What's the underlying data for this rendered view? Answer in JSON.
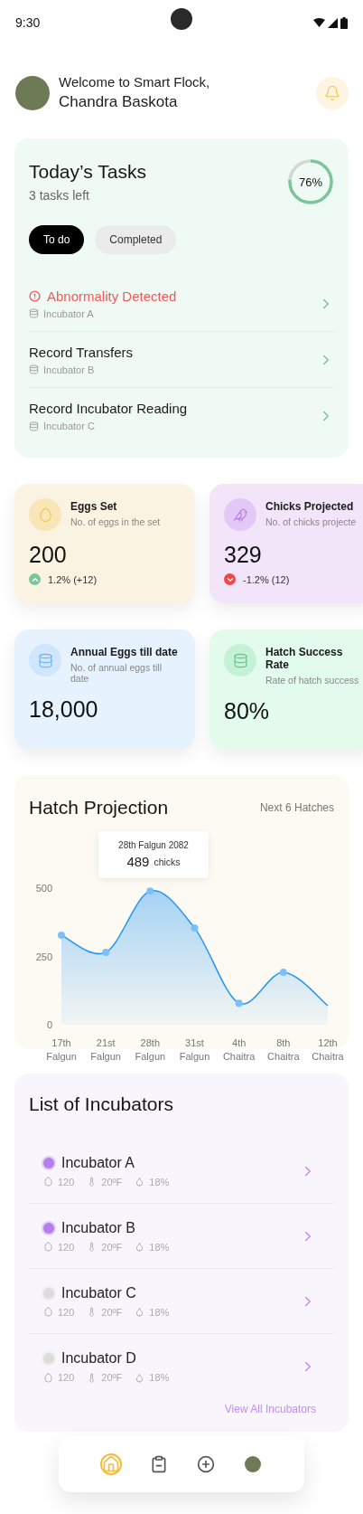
{
  "status_bar": {
    "time": "9:30"
  },
  "header": {
    "greeting": "Welcome to Smart Flock,",
    "name": "Chandra Baskota"
  },
  "tasks": {
    "title": "Today’s Tasks",
    "subtitle": "3 tasks left",
    "progress": {
      "level": 0.76,
      "label": "76%"
    },
    "tabs": [
      {
        "label": "To do",
        "selected": true
      },
      {
        "label": "Completed",
        "selected": false
      }
    ],
    "items": [
      {
        "kind": "alert",
        "title": "Abnormality Detected",
        "incubator": "Incubator A"
      },
      {
        "kind": "normal",
        "title": "Record Transfers",
        "incubator": "Incubator B"
      },
      {
        "kind": "normal",
        "title": "Record Incubator Reading",
        "incubator": "Incubator C"
      }
    ]
  },
  "stats": [
    {
      "kind": "egg",
      "title": "Eggs Set",
      "description": "No. of eggs in the set",
      "value": "200",
      "trend": {
        "kind": "up",
        "text": "1.2% (+12)"
      }
    },
    {
      "kind": "chick",
      "title": "Chicks Projected",
      "description": "No. of chicks projecte",
      "value": "329",
      "trend": {
        "kind": "down",
        "text": "-1.2% (12)"
      }
    },
    {
      "kind": "annual",
      "title": "Annual Eggs till date",
      "description": "No. of annual eggs till date",
      "value": "18,000"
    },
    {
      "kind": "rate",
      "title": "Hatch Success Rate",
      "description": "Rate of hatch success",
      "value": "80%"
    }
  ],
  "projection": {
    "title": "Hatch Projection",
    "subtitle": "Next 6 Hatches",
    "tooltip": {
      "date": "28th Falgun 2082",
      "value": "489",
      "unit": "chicks"
    },
    "chart_data": {
      "type": "area",
      "categories": [
        "17th Falgun",
        "21st Falgun",
        "28th Falgun",
        "31st Falgun",
        "4th Chaitra",
        "8th Chaitra",
        "12th Chaitra"
      ],
      "series": [
        {
          "color": "#2196f3",
          "values": [
            328,
            265,
            489,
            354,
            79,
            192,
            70
          ]
        }
      ],
      "ylim": [
        0,
        500
      ],
      "yticks": [
        0,
        250,
        500
      ]
    }
  },
  "incubators": {
    "title": "List of Incubators",
    "items": [
      {
        "name": "Incubator A",
        "active": true,
        "eggs": "120",
        "temperature": "20ºF",
        "humidity": "18%"
      },
      {
        "name": "Incubator B",
        "active": true,
        "eggs": "120",
        "temperature": "20ºF",
        "humidity": "18%"
      },
      {
        "name": "Incubator C",
        "active": false,
        "eggs": "120",
        "temperature": "20ºF",
        "humidity": "18%"
      },
      {
        "name": "Incubator D",
        "active": false,
        "eggs": "120",
        "temperature": "20ºF",
        "humidity": "18%"
      }
    ],
    "link": "View All Incubators"
  },
  "nav": [
    {
      "kind": "home",
      "selected": true
    },
    {
      "kind": "tasks",
      "selected": false
    },
    {
      "kind": "add",
      "selected": false
    },
    {
      "kind": "profile",
      "selected": false
    }
  ]
}
